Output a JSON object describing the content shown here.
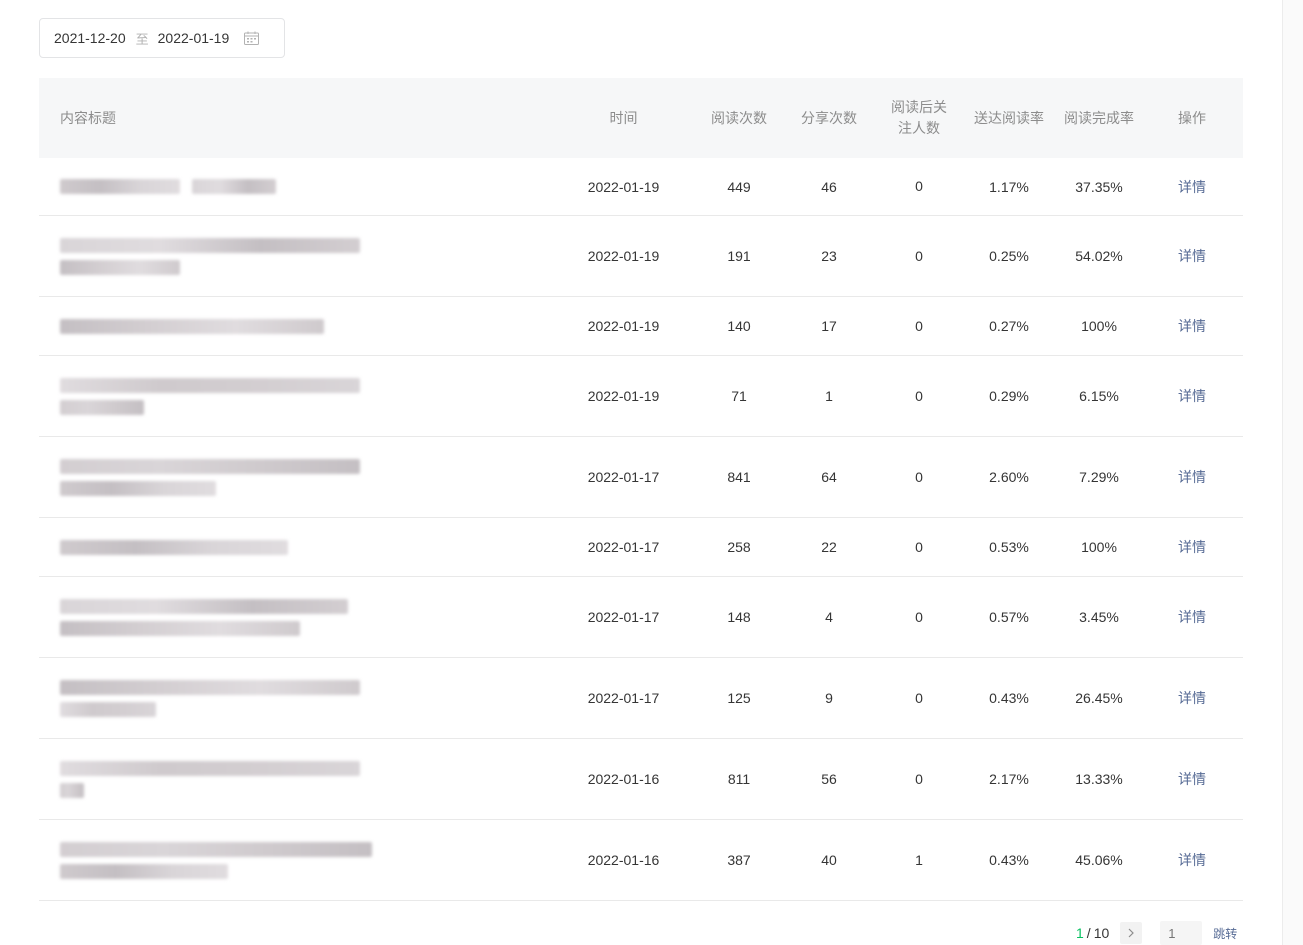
{
  "date_range": {
    "start": "2021-12-20",
    "separator": "至",
    "end": "2022-01-19"
  },
  "table": {
    "headers": {
      "title": "内容标题",
      "time": "时间",
      "reads": "阅读次数",
      "shares": "分享次数",
      "follows": "阅读后关注人数",
      "delivery_rate": "送达阅读率",
      "completion_rate": "阅读完成率",
      "action": "操作"
    },
    "rows": [
      {
        "time": "2022-01-19",
        "reads": "449",
        "shares": "46",
        "follows": "0",
        "delivery_rate": "1.17%",
        "completion_rate": "37.35%",
        "action": "详情"
      },
      {
        "time": "2022-01-19",
        "reads": "191",
        "shares": "23",
        "follows": "0",
        "delivery_rate": "0.25%",
        "completion_rate": "54.02%",
        "action": "详情"
      },
      {
        "time": "2022-01-19",
        "reads": "140",
        "shares": "17",
        "follows": "0",
        "delivery_rate": "0.27%",
        "completion_rate": "100%",
        "action": "详情"
      },
      {
        "time": "2022-01-19",
        "reads": "71",
        "shares": "1",
        "follows": "0",
        "delivery_rate": "0.29%",
        "completion_rate": "6.15%",
        "action": "详情"
      },
      {
        "time": "2022-01-17",
        "reads": "841",
        "shares": "64",
        "follows": "0",
        "delivery_rate": "2.60%",
        "completion_rate": "7.29%",
        "action": "详情"
      },
      {
        "time": "2022-01-17",
        "reads": "258",
        "shares": "22",
        "follows": "0",
        "delivery_rate": "0.53%",
        "completion_rate": "100%",
        "action": "详情"
      },
      {
        "time": "2022-01-17",
        "reads": "148",
        "shares": "4",
        "follows": "0",
        "delivery_rate": "0.57%",
        "completion_rate": "3.45%",
        "action": "详情"
      },
      {
        "time": "2022-01-17",
        "reads": "125",
        "shares": "9",
        "follows": "0",
        "delivery_rate": "0.43%",
        "completion_rate": "26.45%",
        "action": "详情"
      },
      {
        "time": "2022-01-16",
        "reads": "811",
        "shares": "56",
        "follows": "0",
        "delivery_rate": "2.17%",
        "completion_rate": "13.33%",
        "action": "详情"
      },
      {
        "time": "2022-01-16",
        "reads": "387",
        "shares": "40",
        "follows": "1",
        "delivery_rate": "0.43%",
        "completion_rate": "45.06%",
        "action": "详情"
      }
    ]
  },
  "pagination": {
    "current": "1",
    "separator": "/",
    "total": "10",
    "input_placeholder": "1",
    "jump_label": "跳转"
  },
  "colors": {
    "accent_green": "#07c160",
    "link_blue": "#576b95",
    "header_bg": "#f6f7f8"
  }
}
